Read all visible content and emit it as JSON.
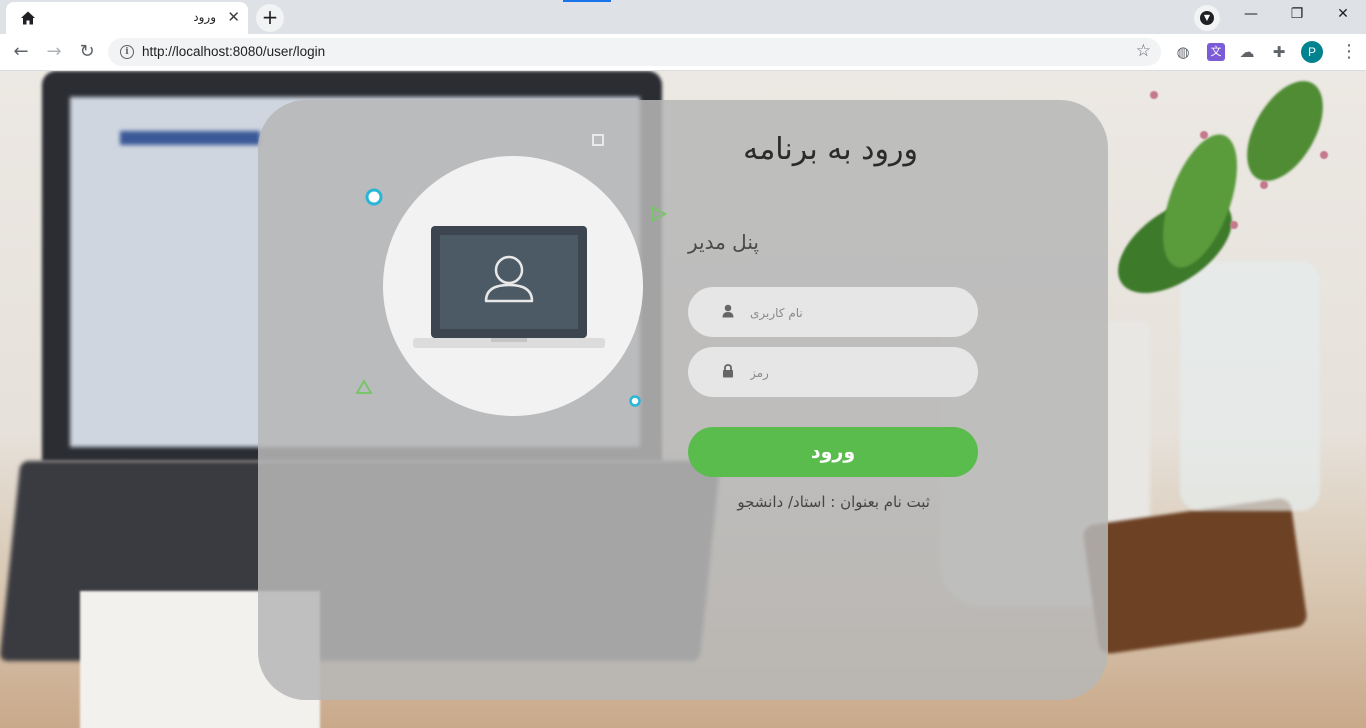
{
  "browser": {
    "tab": {
      "title": "ورود",
      "home_icon": "home-icon",
      "close_label": "✕"
    },
    "new_tab_label": "+",
    "address": {
      "url": "http://localhost:8080/user/login"
    },
    "window_controls": {
      "minimize": "—",
      "restore": "❐",
      "close": "✕"
    },
    "profile_initial": "P",
    "extensions": [
      "globe-icon",
      "translate-icon",
      "cloud-icon",
      "puzzle-icon"
    ]
  },
  "login": {
    "title": "ورود به برنامه",
    "panel_label": "پنل مدیر",
    "username": {
      "placeholder": "نام کاربری",
      "value": ""
    },
    "password": {
      "placeholder": "رمز",
      "value": ""
    },
    "submit_label": "ورود",
    "register_link": "ثبت نام بعنوان : استاد/ دانشجو"
  },
  "colors": {
    "accent_green": "#5bbc4e",
    "card_bg": "#b7b7b7",
    "deco_cyan": "#29b6d6",
    "deco_green": "#7ac46b"
  }
}
